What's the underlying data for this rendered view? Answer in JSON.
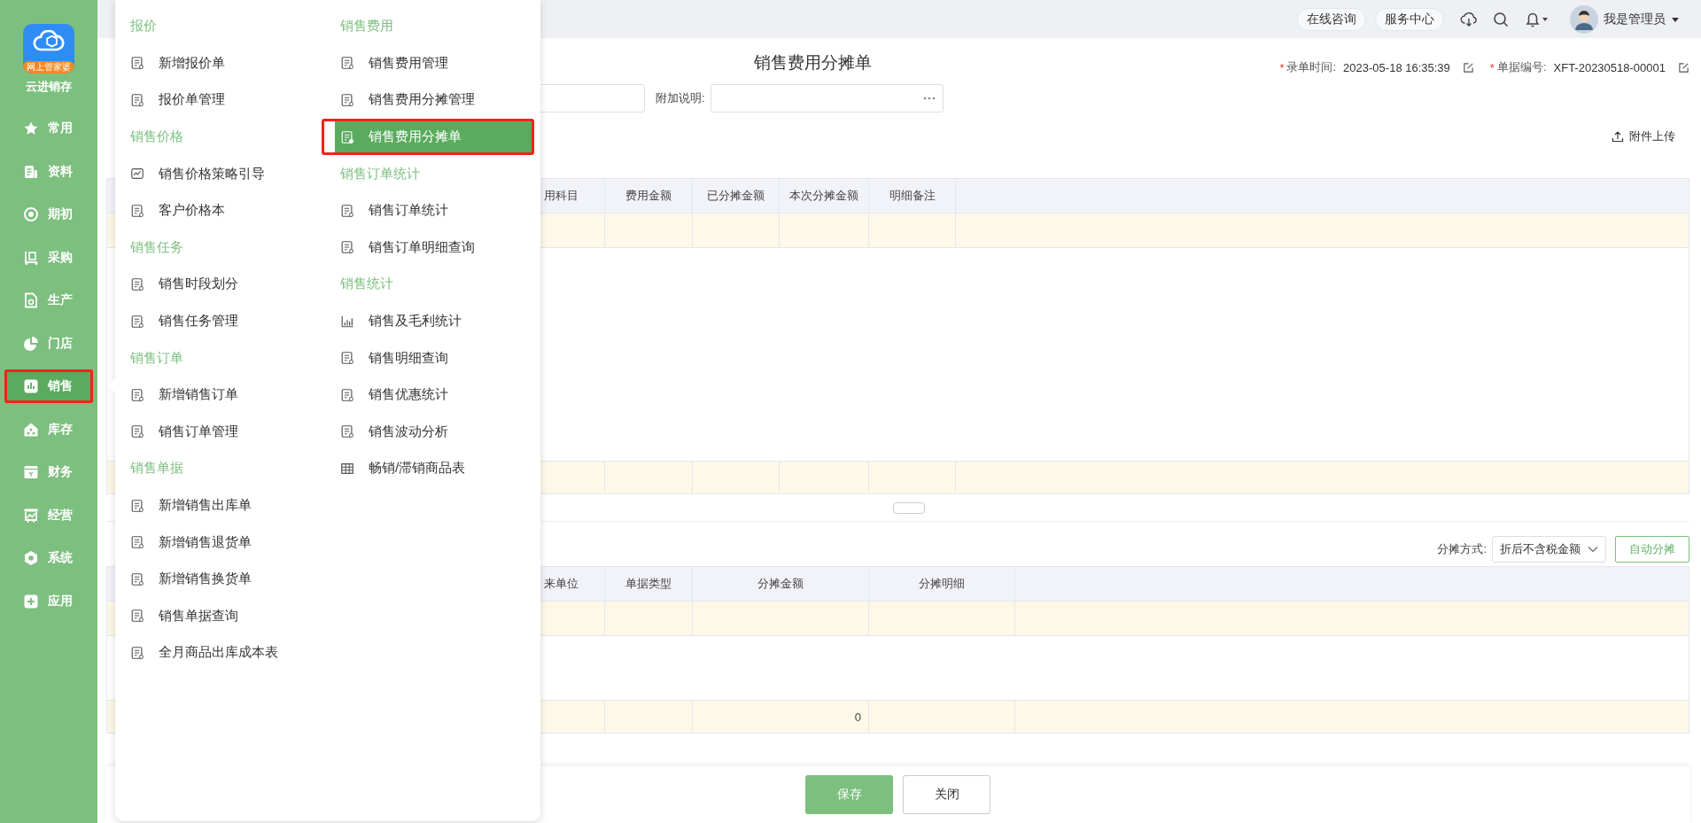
{
  "sidebar": {
    "logo_badge": "网上管家婆",
    "brand": "云进销存",
    "items": [
      {
        "label": "常用",
        "selected": false
      },
      {
        "label": "资料",
        "selected": false
      },
      {
        "label": "期初",
        "selected": false
      },
      {
        "label": "采购",
        "selected": false
      },
      {
        "label": "生产",
        "selected": false
      },
      {
        "label": "门店",
        "selected": false
      },
      {
        "label": "销售",
        "selected": true
      },
      {
        "label": "库存",
        "selected": false
      },
      {
        "label": "财务",
        "selected": false
      },
      {
        "label": "经营",
        "selected": false
      },
      {
        "label": "系统",
        "selected": false
      },
      {
        "label": "应用",
        "selected": false
      }
    ]
  },
  "topbar": {
    "buttons": [
      "在线咨询",
      "服务中心"
    ],
    "user": "我是管理员"
  },
  "form": {
    "title": "销售费用分摊单",
    "meta": [
      {
        "mark": "*",
        "label": "录单时间:",
        "value": "2023-05-18 16:35:39"
      },
      {
        "mark": "*",
        "label": "单据编号:",
        "value": "XFT-20230518-00001"
      }
    ],
    "note_label": "附加说明:",
    "attach": "附件上传"
  },
  "expense_table": {
    "columns": [
      "用科目",
      "费用金额",
      "已分摊金额",
      "本次分摊金额",
      "明细备注"
    ]
  },
  "allocation": {
    "method_label": "分摊方式:",
    "method": "折后不含税金额",
    "auto_button": "自动分摊",
    "columns": [
      "来单位",
      "单据类型",
      "分摊金额",
      "分摊明细"
    ],
    "total": "0"
  },
  "footer": {
    "buttons": [
      {
        "label": "保存",
        "kind": "primary"
      },
      {
        "label": "关闭",
        "kind": "default"
      }
    ]
  },
  "menu": {
    "columns": [
      [
        {
          "kind": "header",
          "label": "报价"
        },
        {
          "kind": "item",
          "label": "新增报价单",
          "selected": false
        },
        {
          "kind": "item",
          "label": "报价单管理",
          "selected": false
        },
        {
          "kind": "header",
          "label": "销售价格"
        },
        {
          "kind": "item",
          "label": "销售价格策略引导",
          "selected": false
        },
        {
          "kind": "item",
          "label": "客户价格本",
          "selected": false
        },
        {
          "kind": "header",
          "label": "销售任务"
        },
        {
          "kind": "item",
          "label": "销售时段划分",
          "selected": false
        },
        {
          "kind": "item",
          "label": "销售任务管理",
          "selected": false
        },
        {
          "kind": "header",
          "label": "销售订单"
        },
        {
          "kind": "item",
          "label": "新增销售订单",
          "selected": false
        },
        {
          "kind": "item",
          "label": "销售订单管理",
          "selected": false
        },
        {
          "kind": "header",
          "label": "销售单据"
        },
        {
          "kind": "item",
          "label": "新增销售出库单",
          "selected": false
        },
        {
          "kind": "item",
          "label": "新增销售退货单",
          "selected": false
        },
        {
          "kind": "item",
          "label": "新增销售换货单",
          "selected": false
        },
        {
          "kind": "item",
          "label": "销售单据查询",
          "selected": false
        },
        {
          "kind": "item",
          "label": "全月商品出库成本表",
          "selected": false
        }
      ],
      [
        {
          "kind": "header",
          "label": "销售费用"
        },
        {
          "kind": "item",
          "label": "销售费用管理",
          "selected": false
        },
        {
          "kind": "item",
          "label": "销售费用分摊管理",
          "selected": false
        },
        {
          "kind": "item",
          "label": "销售费用分摊单",
          "selected": true
        },
        {
          "kind": "header",
          "label": "销售订单统计"
        },
        {
          "kind": "item",
          "label": "销售订单统计",
          "selected": false
        },
        {
          "kind": "item",
          "label": "销售订单明细查询",
          "selected": false
        },
        {
          "kind": "header",
          "label": "销售统计"
        },
        {
          "kind": "item",
          "label": "销售及毛利统计",
          "selected": false
        },
        {
          "kind": "item",
          "label": "销售明细查询",
          "selected": false
        },
        {
          "kind": "item",
          "label": "销售优惠统计",
          "selected": false
        },
        {
          "kind": "item",
          "label": "销售波动分析",
          "selected": false
        },
        {
          "kind": "item",
          "label": "畅销/滞销商品表",
          "selected": false
        }
      ]
    ]
  }
}
